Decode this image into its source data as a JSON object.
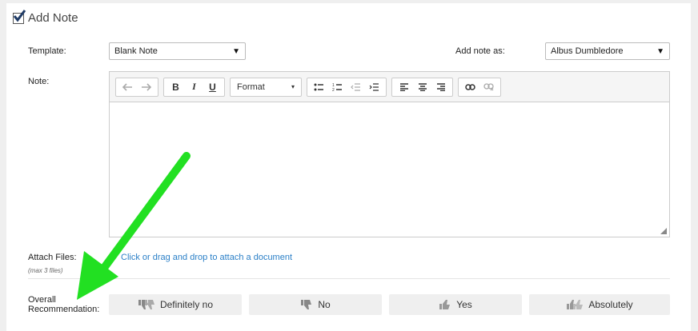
{
  "header": {
    "title": "Add Note",
    "checked": true
  },
  "template": {
    "label": "Template:",
    "value": "Blank Note"
  },
  "add_note_as": {
    "label": "Add note as:",
    "value": "Albus Dumbledore"
  },
  "note": {
    "label": "Note:",
    "format_label": "Format"
  },
  "attach": {
    "label": "Attach Files:",
    "sublabel": "(max 3 files)",
    "link": "Click or drag and drop to attach a document"
  },
  "recommendation": {
    "label_line1": "Overall",
    "label_line2": "Recommendation:",
    "options": [
      "Definitely no",
      "No",
      "Yes",
      "Absolutely"
    ]
  },
  "colors": {
    "link": "#2a7fc7",
    "arrow": "#22e022",
    "check": "#1f3b66"
  }
}
